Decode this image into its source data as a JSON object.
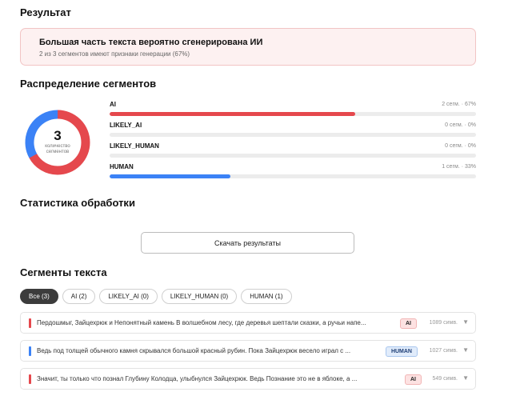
{
  "result": {
    "heading": "Результат",
    "verdict_title": "Большая часть текста вероятно сгенерирована ИИ",
    "verdict_subtitle": "2 из 3 сегментов имеют признаки генерации (67%)"
  },
  "distribution": {
    "heading": "Распределение сегментов",
    "donut_total": "3",
    "donut_caption_line1": "количество",
    "donut_caption_line2": "сегментов",
    "bars": [
      {
        "label": "AI",
        "value_text": "2 сегм. · 67%",
        "fraction": 0.67,
        "color": "#e5484d"
      },
      {
        "label": "LIKELY_AI",
        "value_text": "0 сегм. · 0%",
        "fraction": 0,
        "color": "#e5484d"
      },
      {
        "label": "LIKELY_HUMAN",
        "value_text": "0 сегм. · 0%",
        "fraction": 0,
        "color": "#3b82f6"
      },
      {
        "label": "HUMAN",
        "value_text": "1 сегм. · 33%",
        "fraction": 0.33,
        "color": "#3b82f6"
      }
    ]
  },
  "processing": {
    "heading": "Статистика обработки",
    "download_label": "Скачать результаты"
  },
  "segments": {
    "heading": "Сегменты текста",
    "filters": [
      {
        "label": "Все (3)",
        "active": true
      },
      {
        "label": "AI (2)",
        "active": false
      },
      {
        "label": "LIKELY_AI (0)",
        "active": false
      },
      {
        "label": "LIKELY_HUMAN (0)",
        "active": false
      },
      {
        "label": "HUMAN (1)",
        "active": false
      }
    ],
    "items": [
      {
        "text": "Пердошмыг, Зайцехрюк и Непонятный камень В волшебном лесу, где деревья шептали сказки, а ручьи напе...",
        "badge": "AI",
        "length": "1089 симв.",
        "marker_color": "#e5484d"
      },
      {
        "text": "Ведь под толщей обычного камня скрывался большой красный рубин. Пока Зайцехрюк весело играл с ...",
        "badge": "HUMAN",
        "length": "1027 симв.",
        "marker_color": "#3b82f6"
      },
      {
        "text": "Значит, ты только что познал Глубину Колодца, улыбнулся Зайцехрюк. Ведь Познание это не в яблоке, а ...",
        "badge": "AI",
        "length": "549 симв.",
        "marker_color": "#e5484d"
      }
    ],
    "expand_icon": "chevron-down-icon"
  },
  "colors": {
    "ai": "#e5484d",
    "human": "#3b82f6",
    "verdict_bg": "#fdf1f1",
    "verdict_border": "#f2c4c4"
  }
}
